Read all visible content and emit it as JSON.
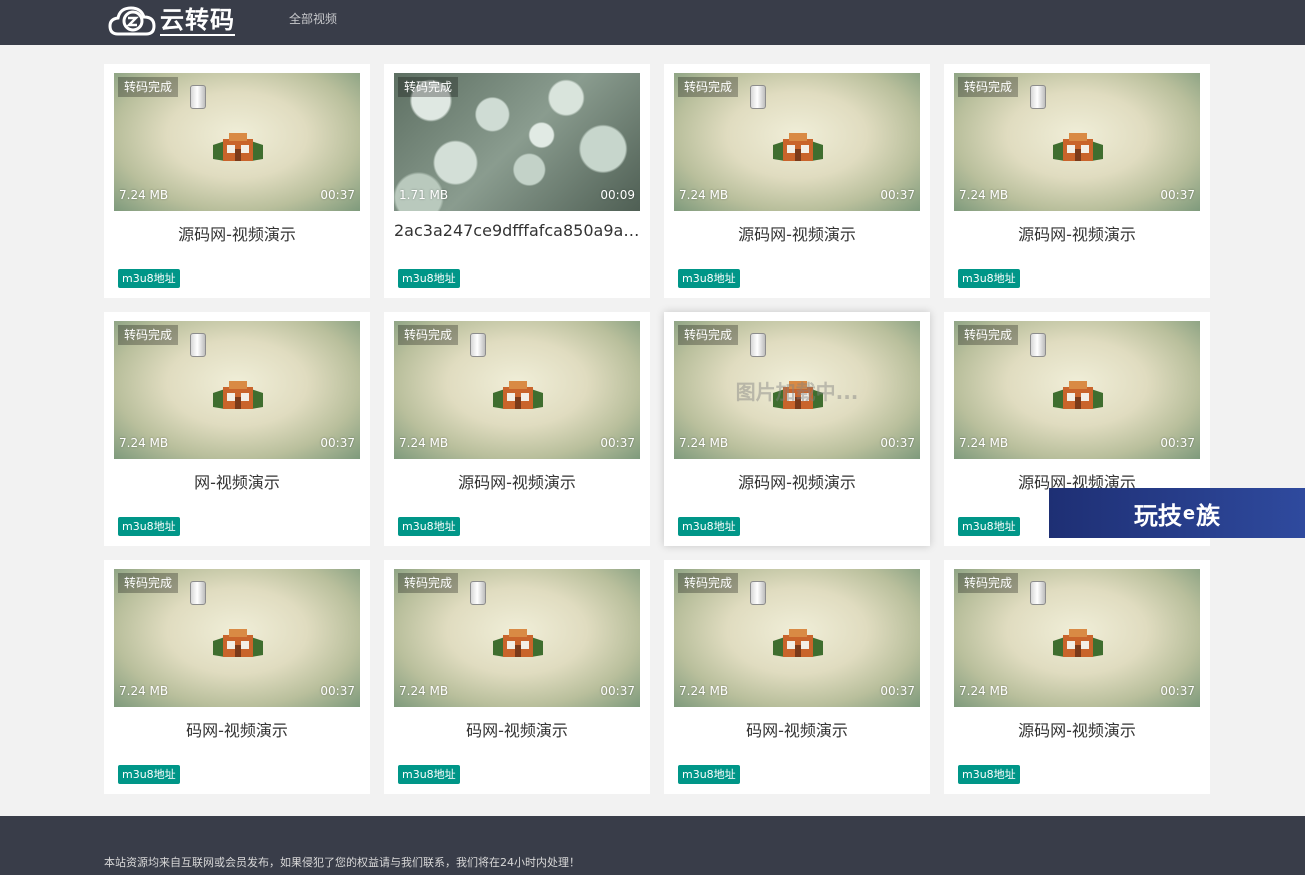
{
  "header": {
    "logo_text": "云转码",
    "nav": [
      "全部视频"
    ]
  },
  "colors": {
    "header_bg": "#393d49",
    "page_bg": "#f2f2f2",
    "tag_bg": "#009688"
  },
  "videos": [
    {
      "status": "转码完成",
      "size": "7.24 MB",
      "duration": "00:37",
      "title": "源码网-视频演示",
      "tag": "m3u8地址"
    },
    {
      "status": "转码完成",
      "size": "1.71 MB",
      "duration": "00:09",
      "title": "2ac3a247ce9dfffafca850a9aa...",
      "tag": "m3u8地址"
    },
    {
      "status": "转码完成",
      "size": "7.24 MB",
      "duration": "00:37",
      "title": "源码网-视频演示",
      "tag": "m3u8地址"
    },
    {
      "status": "转码完成",
      "size": "7.24 MB",
      "duration": "00:37",
      "title": "源码网-视频演示",
      "tag": "m3u8地址"
    },
    {
      "status": "转码完成",
      "size": "7.24 MB",
      "duration": "00:37",
      "title": "网-视频演示",
      "tag": "m3u8地址"
    },
    {
      "status": "转码完成",
      "size": "7.24 MB",
      "duration": "00:37",
      "title": "源码网-视频演示",
      "tag": "m3u8地址"
    },
    {
      "status": "转码完成",
      "size": "7.24 MB",
      "duration": "00:37",
      "title": "源码网-视频演示",
      "tag": "m3u8地址",
      "overlay": "图片加载中..."
    },
    {
      "status": "转码完成",
      "size": "7.24 MB",
      "duration": "00:37",
      "title": "源码网-视频演示",
      "tag": "m3u8地址"
    },
    {
      "status": "转码完成",
      "size": "7.24 MB",
      "duration": "00:37",
      "title": "码网-视频演示",
      "tag": "m3u8地址"
    },
    {
      "status": "转码完成",
      "size": "7.24 MB",
      "duration": "00:37",
      "title": "码网-视频演示",
      "tag": "m3u8地址"
    },
    {
      "status": "转码完成",
      "size": "7.24 MB",
      "duration": "00:37",
      "title": "码网-视频演示",
      "tag": "m3u8地址"
    },
    {
      "status": "转码完成",
      "size": "7.24 MB",
      "duration": "00:37",
      "title": "源码网-视频演示",
      "tag": "m3u8地址"
    }
  ],
  "watermark": {
    "part1": "玩技",
    "part2": "e",
    "part3": "族"
  },
  "footer": {
    "text": "本站资源均来自互联网或会员发布，如果侵犯了您的权益请与我们联系，我们将在24小时内处理！"
  }
}
